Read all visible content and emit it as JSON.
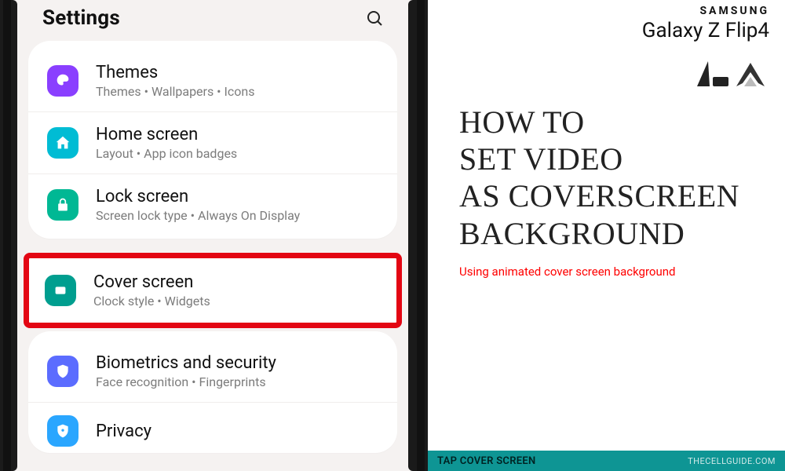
{
  "settings": {
    "title": "Settings",
    "groups": [
      {
        "items": [
          {
            "key": "themes",
            "title": "Themes",
            "sub": "Themes  •  Wallpapers  •  Icons",
            "iconColor": "#8a3fff"
          },
          {
            "key": "homescreen",
            "title": "Home screen",
            "sub": "Layout  •  App icon badges",
            "iconColor": "#00bcd4"
          },
          {
            "key": "lockscreen",
            "title": "Lock screen",
            "sub": "Screen lock type  •  Always On Display",
            "iconColor": "#00b894"
          }
        ]
      },
      {
        "highlighted": true,
        "items": [
          {
            "key": "coverscreen",
            "title": "Cover screen",
            "sub": "Clock style  •  Widgets",
            "iconColor": "#009e8f"
          }
        ]
      },
      {
        "items": [
          {
            "key": "biometrics",
            "title": "Biometrics and security",
            "sub": "Face recognition  •  Fingerprints",
            "iconColor": "#5b6cff"
          },
          {
            "key": "privacy",
            "title": "Privacy",
            "sub": "",
            "iconColor": "#2aa6ff"
          }
        ]
      }
    ]
  },
  "brand": {
    "maker": "SAMSUNG",
    "model": "Galaxy Z Flip4"
  },
  "howto": {
    "lines": [
      "HOW TO",
      "SET VIDEO",
      "AS COVERSCREEN",
      "BACKGROUND"
    ],
    "sub": "Using animated cover screen background"
  },
  "caption": {
    "left": "TAP COVER SCREEN",
    "right": "THECELLGUIDE.COM"
  }
}
